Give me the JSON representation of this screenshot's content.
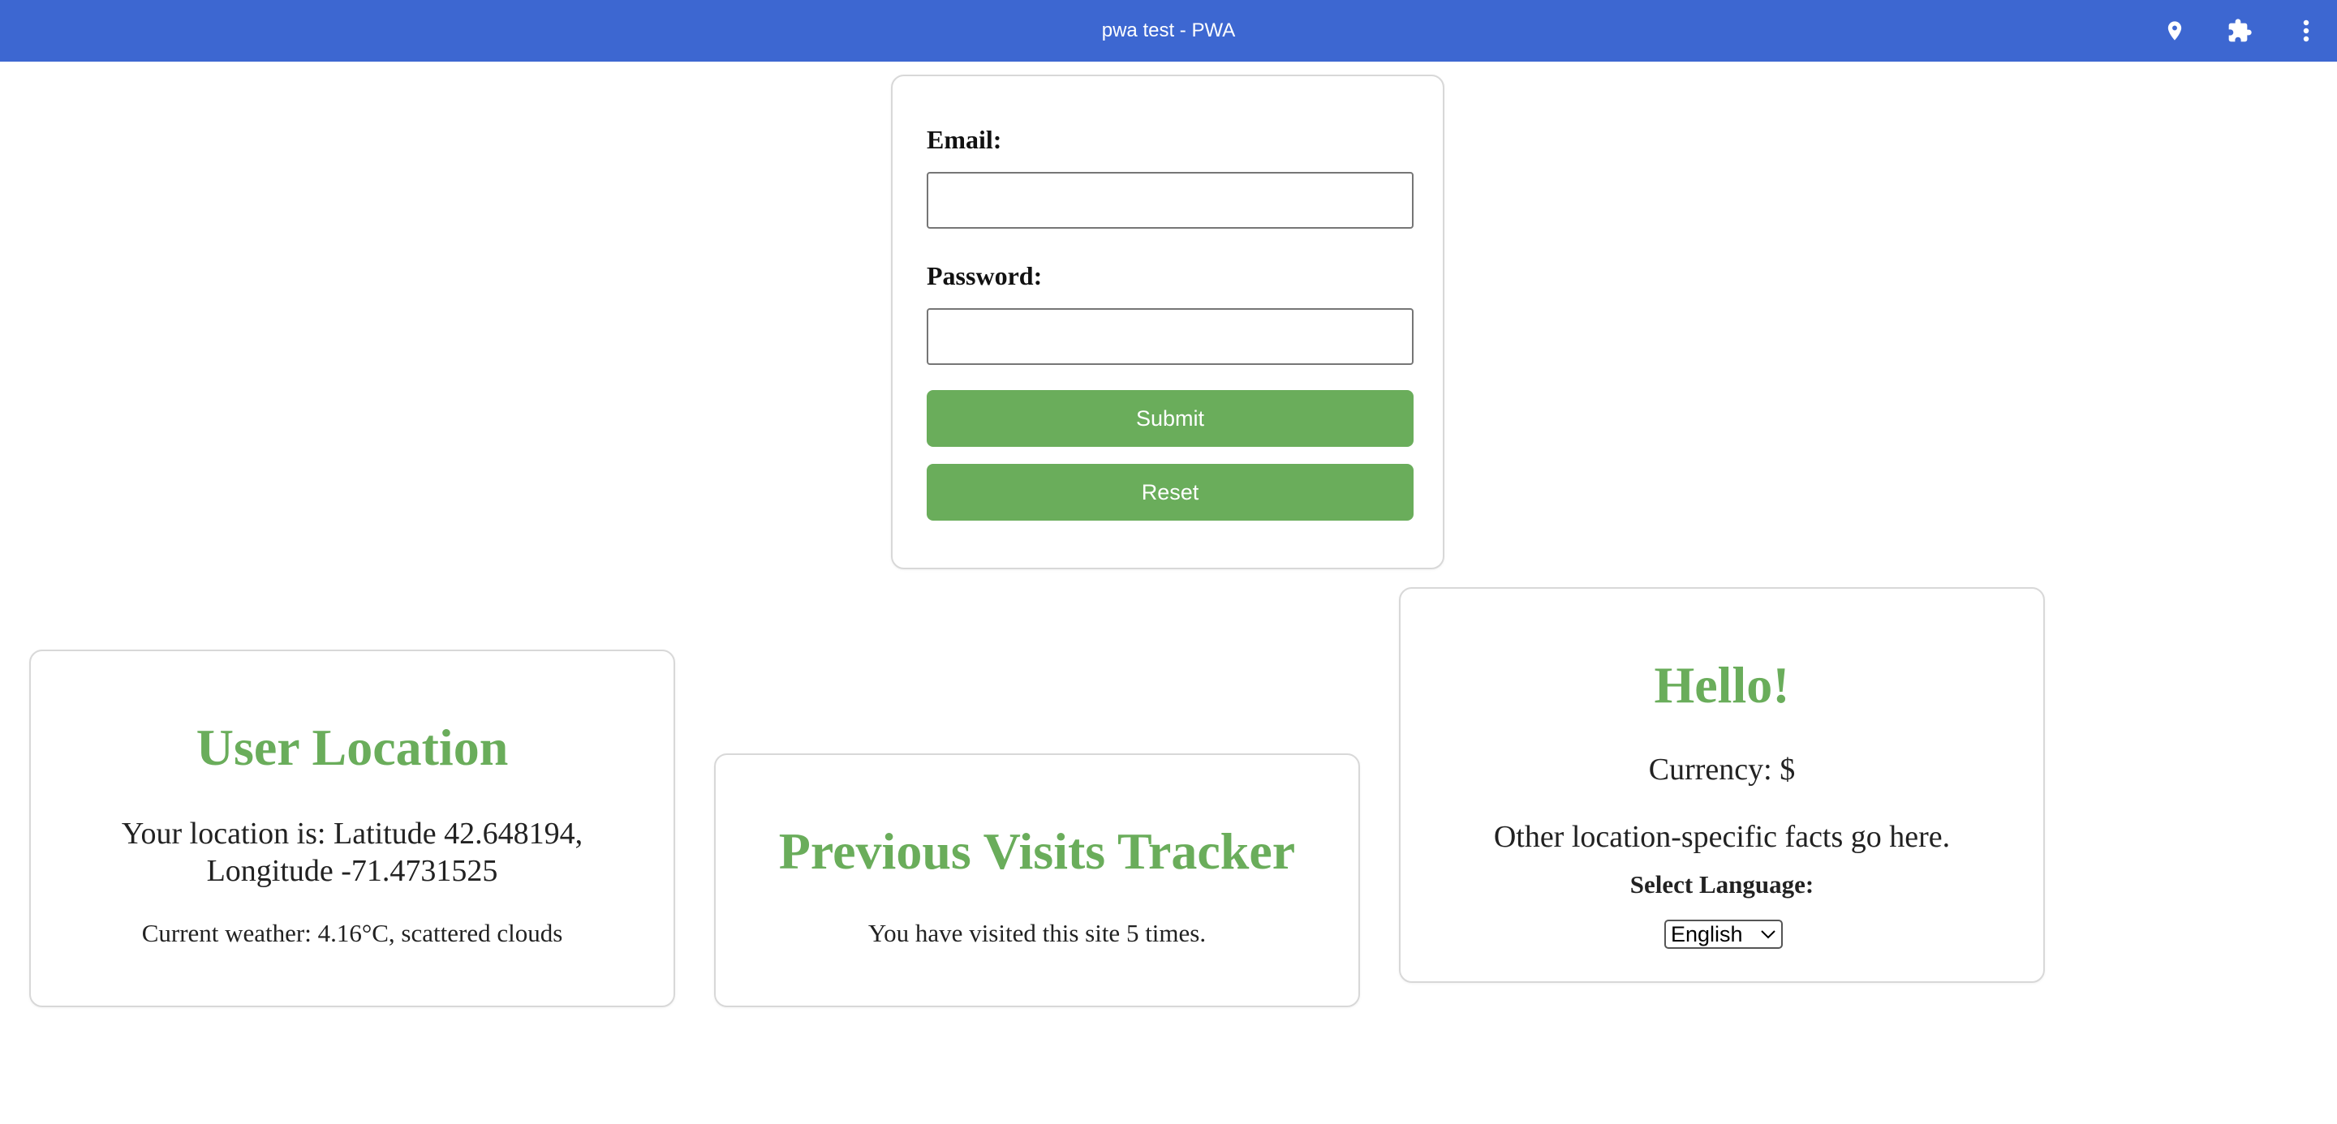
{
  "window": {
    "title": "pwa test - PWA",
    "icons": [
      "location-pin-icon",
      "extensions-puzzle-icon",
      "more-vertical-icon"
    ]
  },
  "login": {
    "email_label": "Email:",
    "email_value": "",
    "password_label": "Password:",
    "password_value": "",
    "submit_label": "Submit",
    "reset_label": "Reset"
  },
  "location_card": {
    "title": "User Location",
    "location_line1": "Your location is: Latitude 42.648194,",
    "location_line2": "Longitude -71.4731525",
    "weather": "Current weather: 4.16°C, scattered clouds"
  },
  "visits_card": {
    "title": "Previous Visits Tracker",
    "message": "You have visited this site 5 times."
  },
  "hello_card": {
    "title": "Hello!",
    "currency": "Currency: $",
    "facts": "Other location-specific facts go here.",
    "language_label": "Select Language:",
    "language_selected": "English"
  },
  "colors": {
    "titlebar": "#3d67d1",
    "accent_green": "#6aad5b"
  }
}
